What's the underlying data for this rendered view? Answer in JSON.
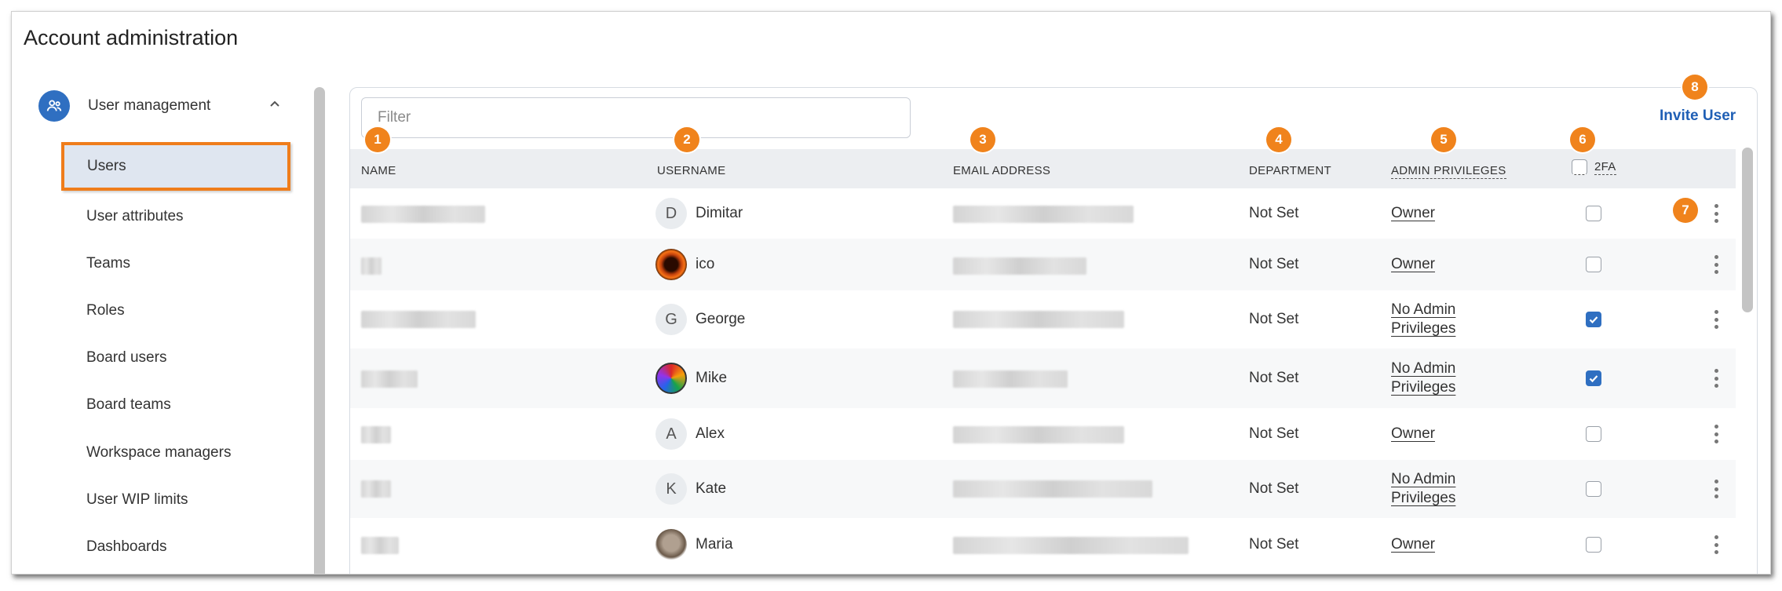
{
  "page_title": "Account administration",
  "sidebar": {
    "group_label": "User management",
    "group_icon": "users-gear-icon",
    "items": [
      {
        "label": "Users",
        "active": true
      },
      {
        "label": "User attributes"
      },
      {
        "label": "Teams"
      },
      {
        "label": "Roles"
      },
      {
        "label": "Board users"
      },
      {
        "label": "Board teams"
      },
      {
        "label": "Workspace managers"
      },
      {
        "label": "User WIP limits"
      },
      {
        "label": "Dashboards"
      }
    ]
  },
  "main": {
    "filter_placeholder": "Filter",
    "invite_label": "Invite User",
    "columns": {
      "name": "NAME",
      "username": "USERNAME",
      "email": "EMAIL ADDRESS",
      "department": "DEPARTMENT",
      "admin": "ADMIN PRIVILEGES",
      "twofa": "2FA"
    },
    "rows": [
      {
        "initial": "D",
        "username": "Dimitar",
        "department": "Not Set",
        "privileges": "Owner",
        "twofa": false
      },
      {
        "initial": "",
        "username": "ico",
        "department": "Not Set",
        "privileges": "Owner",
        "twofa": false
      },
      {
        "initial": "G",
        "username": "George",
        "department": "Not Set",
        "privileges": "No Admin Privileges",
        "privileges_l1": "No Admin",
        "privileges_l2": "Privileges",
        "twofa": true
      },
      {
        "initial": "",
        "username": "Mike",
        "department": "Not Set",
        "privileges": "No Admin Privileges",
        "privileges_l1": "No Admin",
        "privileges_l2": "Privileges",
        "twofa": true
      },
      {
        "initial": "A",
        "username": "Alex",
        "department": "Not Set",
        "privileges": "Owner",
        "twofa": false
      },
      {
        "initial": "K",
        "username": "Kate",
        "department": "Not Set",
        "privileges": "No Admin Privileges",
        "privileges_l1": "No Admin",
        "privileges_l2": "Privileges",
        "twofa": false
      },
      {
        "initial": "",
        "username": "Maria",
        "department": "Not Set",
        "privileges": "Owner",
        "twofa": false
      }
    ]
  },
  "callouts": [
    "1",
    "2",
    "3",
    "4",
    "5",
    "6",
    "7",
    "8"
  ],
  "colors": {
    "accent": "#2f6fc1",
    "callout": "#f0831c",
    "highlight_border": "#ef7d1b",
    "link": "#1f5fb5"
  }
}
